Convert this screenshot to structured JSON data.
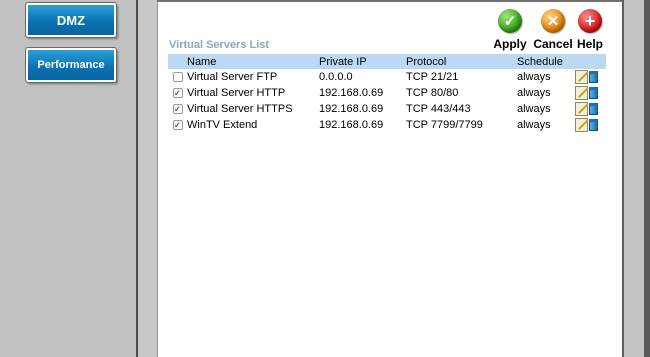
{
  "nav": {
    "dmz_label": "DMZ",
    "performance_label": "Performance"
  },
  "actions": {
    "apply_label": "Apply",
    "cancel_label": "Cancel",
    "help_label": "Help",
    "apply_glyph": "✓",
    "cancel_glyph": "✕",
    "help_glyph": "+"
  },
  "section": {
    "title": "Virtual Servers List"
  },
  "table": {
    "headers": {
      "name": "Name",
      "ip": "Private IP",
      "protocol": "Protocol",
      "schedule": "Schedule"
    },
    "rows": [
      {
        "checked": "",
        "name": "Virtual Server FTP",
        "ip": "0.0.0.0",
        "protocol": "TCP 21/21",
        "schedule": "always"
      },
      {
        "checked": "✓",
        "name": "Virtual Server HTTP",
        "ip": "192.168.0.69",
        "protocol": "TCP 80/80",
        "schedule": "always"
      },
      {
        "checked": "✓",
        "name": "Virtual Server HTTPS",
        "ip": "192.168.0.69",
        "protocol": "TCP 443/443",
        "schedule": "always"
      },
      {
        "checked": "✓",
        "name": "WinTV Extend",
        "ip": "192.168.0.69",
        "protocol": "TCP 7799/7799",
        "schedule": "always"
      }
    ]
  },
  "icons": [
    "edit-icon",
    "trash-icon",
    "checkmark-icon",
    "cancel-icon",
    "help-icon"
  ],
  "colors": {
    "header_bg": "#bcd9f4",
    "nav_button": "#0a6fb0",
    "section_title": "#8fa6b6"
  }
}
